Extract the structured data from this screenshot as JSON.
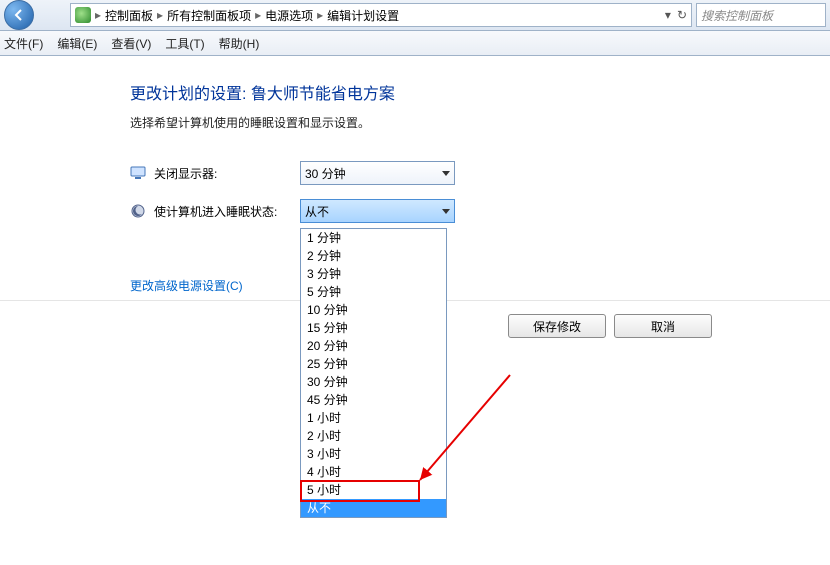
{
  "breadcrumb": {
    "items": [
      "控制面板",
      "所有控制面板项",
      "电源选项",
      "编辑计划设置"
    ]
  },
  "search": {
    "placeholder": "搜索控制面板"
  },
  "menu": {
    "file": "文件(F)",
    "edit": "编辑(E)",
    "view": "查看(V)",
    "tools": "工具(T)",
    "help": "帮助(H)"
  },
  "page": {
    "heading": "更改计划的设置: 鲁大师节能省电方案",
    "subtext": "选择希望计算机使用的睡眠设置和显示设置。"
  },
  "settings": {
    "display_off": {
      "label": "关闭显示器:",
      "value": "30 分钟"
    },
    "sleep": {
      "label": "使计算机进入睡眠状态:",
      "value": "从不"
    }
  },
  "dropdown_options": [
    "1 分钟",
    "2 分钟",
    "3 分钟",
    "5 分钟",
    "10 分钟",
    "15 分钟",
    "20 分钟",
    "25 分钟",
    "30 分钟",
    "45 分钟",
    "1 小时",
    "2 小时",
    "3 小时",
    "4 小时",
    "5 小时",
    "从不"
  ],
  "dropdown_selected": "从不",
  "links": {
    "advanced": "更改高级电源设置(C)"
  },
  "buttons": {
    "save": "保存修改",
    "cancel": "取消"
  }
}
